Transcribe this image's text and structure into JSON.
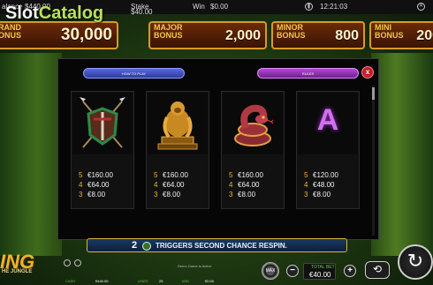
{
  "topbar": {
    "balance_label": "alance",
    "balance_value": "$440.00",
    "stake_label": "Stake",
    "stake_value": "$40.00",
    "win_label": "Win",
    "win_value": "$0.00",
    "clock": "12:21:03",
    "icons": [
      "pause-icon",
      "close-icon"
    ]
  },
  "watermark": {
    "part1": "Slot",
    "part2": "Catalog"
  },
  "jackpots": [
    {
      "name": "GRAND\nBONUS",
      "name_visible": "RAND\nONUS",
      "value": "30,000"
    },
    {
      "name": "MAJOR\nBONUS",
      "value": "2,000"
    },
    {
      "name": "MINOR\nBONUS",
      "value": "800"
    },
    {
      "name": "MINI\nBONUS",
      "value": "200"
    }
  ],
  "paytable": {
    "tab_how_to_play": "HOW TO PLAY",
    "tab_rules": "RULES",
    "close_label": "x",
    "symbols": [
      {
        "icon": "tribal-shield-icon",
        "pays": [
          {
            "count": "5",
            "value": "€160.00"
          },
          {
            "count": "4",
            "value": "€64.00"
          },
          {
            "count": "3",
            "value": "€8.00"
          }
        ]
      },
      {
        "icon": "gorilla-idol-icon",
        "pays": [
          {
            "count": "5",
            "value": "€160.00"
          },
          {
            "count": "4",
            "value": "€64.00"
          },
          {
            "count": "3",
            "value": "€8.00"
          }
        ]
      },
      {
        "icon": "snake-icon",
        "pays": [
          {
            "count": "5",
            "value": "€160.00"
          },
          {
            "count": "4",
            "value": "€64.00"
          },
          {
            "count": "3",
            "value": "€8.00"
          }
        ]
      },
      {
        "icon": "letter-a-icon",
        "letter": "A",
        "pays": [
          {
            "count": "5",
            "value": "€120.00"
          },
          {
            "count": "4",
            "value": "€48.00"
          },
          {
            "count": "3",
            "value": "€8.00"
          }
        ]
      }
    ]
  },
  "trigger_bar": {
    "number": "2",
    "text": "TRIGGERS SECOND CHANCE RESPIN."
  },
  "game_title": {
    "main": "ING",
    "sub": "HE JUNGLE"
  },
  "bottom": {
    "cash_label": "CASH",
    "cash_value": "€440.00",
    "lines_label": "LINES",
    "lines_value": "25",
    "win_label": "WIN",
    "win_value": "€0.00",
    "demo_text": "Demo Game is Active",
    "chip_label": "MAX",
    "minus_label": "−",
    "plus_label": "+",
    "total_bet_label": "TOTAL BET",
    "total_bet_value": "€40.00",
    "auto_label": "⟲",
    "spin_label": "↻"
  },
  "colors": {
    "accent_gold": "#d79a25",
    "pay_count": "#f2b33a",
    "label_green": "#67c24a",
    "close_red": "#c0202a"
  }
}
